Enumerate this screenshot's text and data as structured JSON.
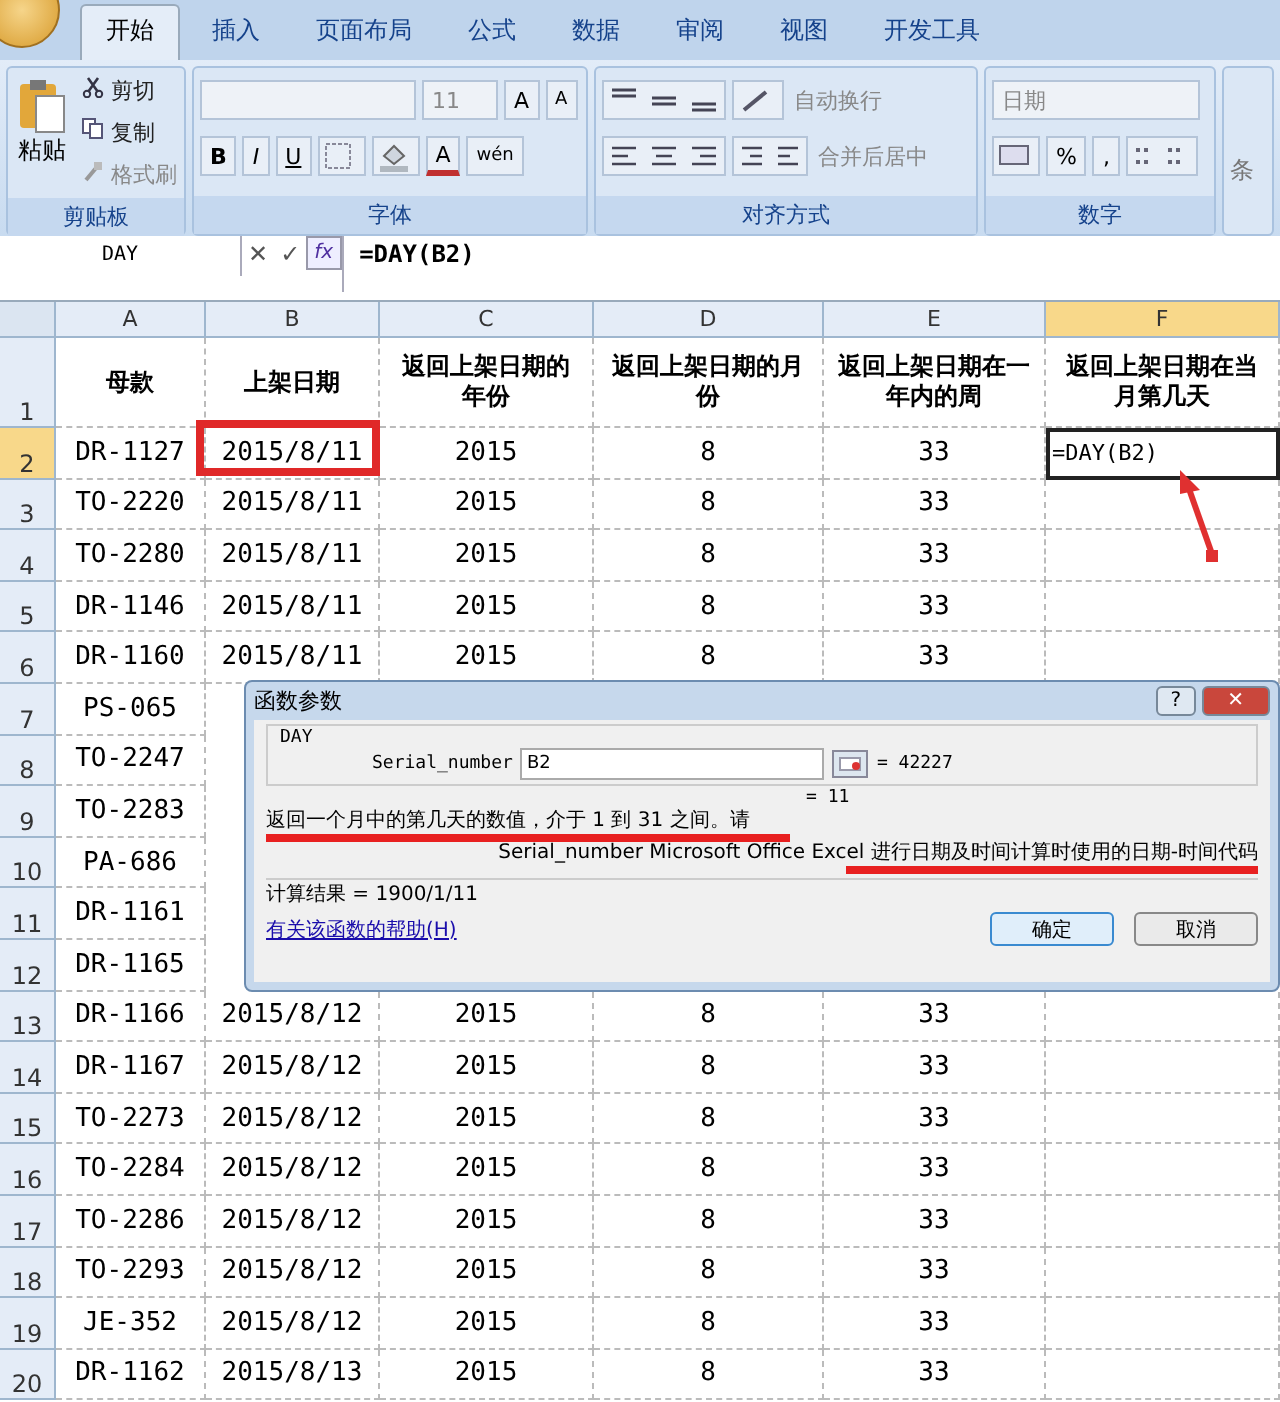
{
  "ribbon": {
    "tabs": [
      {
        "label": "开始",
        "selected": true
      },
      {
        "label": "插入",
        "selected": false
      },
      {
        "label": "页面布局",
        "selected": false
      },
      {
        "label": "公式",
        "selected": false
      },
      {
        "label": "数据",
        "selected": false
      },
      {
        "label": "审阅",
        "selected": false
      },
      {
        "label": "视图",
        "selected": false
      },
      {
        "label": "开发工具",
        "selected": false
      }
    ],
    "clipboard": {
      "paste": "粘贴",
      "cut": "剪切",
      "copy": "复制",
      "format_painter": "格式刷",
      "group": "剪贴板"
    },
    "font": {
      "size": "11",
      "grow": "A",
      "shrink": "A",
      "bold": "B",
      "italic": "I",
      "underline": "U",
      "font_color": "A",
      "phonetic": "wén",
      "group": "字体"
    },
    "alignment": {
      "wrap": "自动换行",
      "merge": "合并后居中",
      "group": "对齐方式"
    },
    "number": {
      "format": "日期",
      "percent": "%",
      "comma": ",",
      "group": "数字"
    },
    "styles": {
      "partial": "条"
    }
  },
  "formula_bar": {
    "name_box": "DAY",
    "cancel": "✕",
    "enter": "✓",
    "fx": "fx",
    "formula": "=DAY(B2)"
  },
  "columns": [
    {
      "label": "A",
      "selected": false
    },
    {
      "label": "B",
      "selected": false
    },
    {
      "label": "C",
      "selected": false
    },
    {
      "label": "D",
      "selected": false
    },
    {
      "label": "E",
      "selected": false
    },
    {
      "label": "F",
      "selected": true
    }
  ],
  "header_row": {
    "number": "1",
    "cells": [
      "母款",
      "上架日期",
      "返回上架日期的年份",
      "返回上架日期的月份",
      "返回上架日期在一年内的周",
      "返回上架日期在当月第几天"
    ]
  },
  "rows": [
    {
      "number": "2",
      "selected": true,
      "cells": [
        "DR-1127",
        "2015/8/11",
        "2015",
        "8",
        "33",
        "=DAY(B2)"
      ]
    },
    {
      "number": "3",
      "selected": false,
      "cells": [
        "TO-2220",
        "2015/8/11",
        "2015",
        "8",
        "33",
        ""
      ]
    },
    {
      "number": "4",
      "selected": false,
      "cells": [
        "TO-2280",
        "2015/8/11",
        "2015",
        "8",
        "33",
        ""
      ]
    },
    {
      "number": "5",
      "selected": false,
      "cells": [
        "DR-1146",
        "2015/8/11",
        "2015",
        "8",
        "33",
        ""
      ]
    },
    {
      "number": "6",
      "selected": false,
      "cells": [
        "DR-1160",
        "2015/8/11",
        "2015",
        "8",
        "33",
        ""
      ]
    },
    {
      "number": "7",
      "selected": false,
      "cells": [
        "PS-065"
      ]
    },
    {
      "number": "8",
      "selected": false,
      "cells": [
        "TO-2247"
      ]
    },
    {
      "number": "9",
      "selected": false,
      "cells": [
        "TO-2283"
      ]
    },
    {
      "number": "10",
      "selected": false,
      "cells": [
        "PA-686"
      ]
    },
    {
      "number": "11",
      "selected": false,
      "cells": [
        "DR-1161"
      ]
    },
    {
      "number": "12",
      "selected": false,
      "cells": [
        "DR-1165"
      ]
    },
    {
      "number": "13",
      "selected": false,
      "cells": [
        "DR-1166",
        "2015/8/12",
        "2015",
        "8",
        "33",
        ""
      ]
    },
    {
      "number": "14",
      "selected": false,
      "cells": [
        "DR-1167",
        "2015/8/12",
        "2015",
        "8",
        "33",
        ""
      ]
    },
    {
      "number": "15",
      "selected": false,
      "cells": [
        "TO-2273",
        "2015/8/12",
        "2015",
        "8",
        "33",
        ""
      ]
    },
    {
      "number": "16",
      "selected": false,
      "cells": [
        "TO-2284",
        "2015/8/12",
        "2015",
        "8",
        "33",
        ""
      ]
    },
    {
      "number": "17",
      "selected": false,
      "cells": [
        "TO-2286",
        "2015/8/12",
        "2015",
        "8",
        "33",
        ""
      ]
    },
    {
      "number": "18",
      "selected": false,
      "cells": [
        "TO-2293",
        "2015/8/12",
        "2015",
        "8",
        "33",
        ""
      ]
    },
    {
      "number": "19",
      "selected": false,
      "cells": [
        "JE-352",
        "2015/8/12",
        "2015",
        "8",
        "33",
        ""
      ]
    },
    {
      "number": "20",
      "selected": false,
      "cells": [
        "DR-1162",
        "2015/8/13",
        "2015",
        "8",
        "33",
        ""
      ]
    }
  ],
  "dialog": {
    "title": "函数参数",
    "help": "?",
    "close": "✕",
    "function": "DAY",
    "argument_label": "Serial_number",
    "argument_value": "B2",
    "argument_result": "= 42227",
    "result_preview": "= 11",
    "description": "返回一个月中的第几天的数值，介于 1 到 31 之间。请",
    "argument_help": "Serial_number Microsoft Office Excel 进行日期及时间计算时使用的日期-时间代码",
    "result": "计算结果 = 1900/1/11",
    "help_link": "有关该函数的帮助(H)",
    "ok": "确定",
    "cancel": "取消"
  }
}
